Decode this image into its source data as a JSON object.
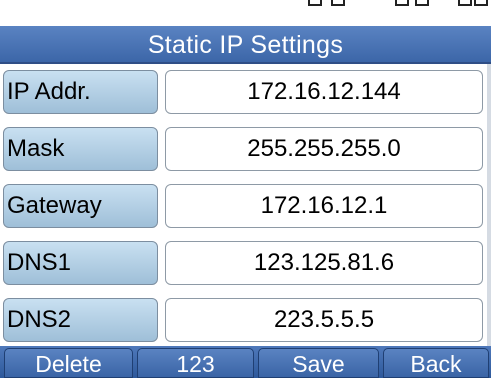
{
  "title": "Static IP Settings",
  "fields": [
    {
      "label": "IP  Addr.",
      "value": "172.16.12.144"
    },
    {
      "label": "Mask",
      "value": "255.255.255.0"
    },
    {
      "label": "Gateway",
      "value": "172.16.12.1"
    },
    {
      "label": "DNS1",
      "value": "123.125.81.6"
    },
    {
      "label": "DNS2",
      "value": "223.5.5.5"
    }
  ],
  "softkeys": [
    {
      "label": "Delete"
    },
    {
      "label": "123"
    },
    {
      "label": "Save"
    },
    {
      "label": "Back"
    }
  ],
  "colors": {
    "title_bar": "#4a74b6",
    "label_cell": "#b6d2e8",
    "softkey_bar": "#3a64a6"
  }
}
